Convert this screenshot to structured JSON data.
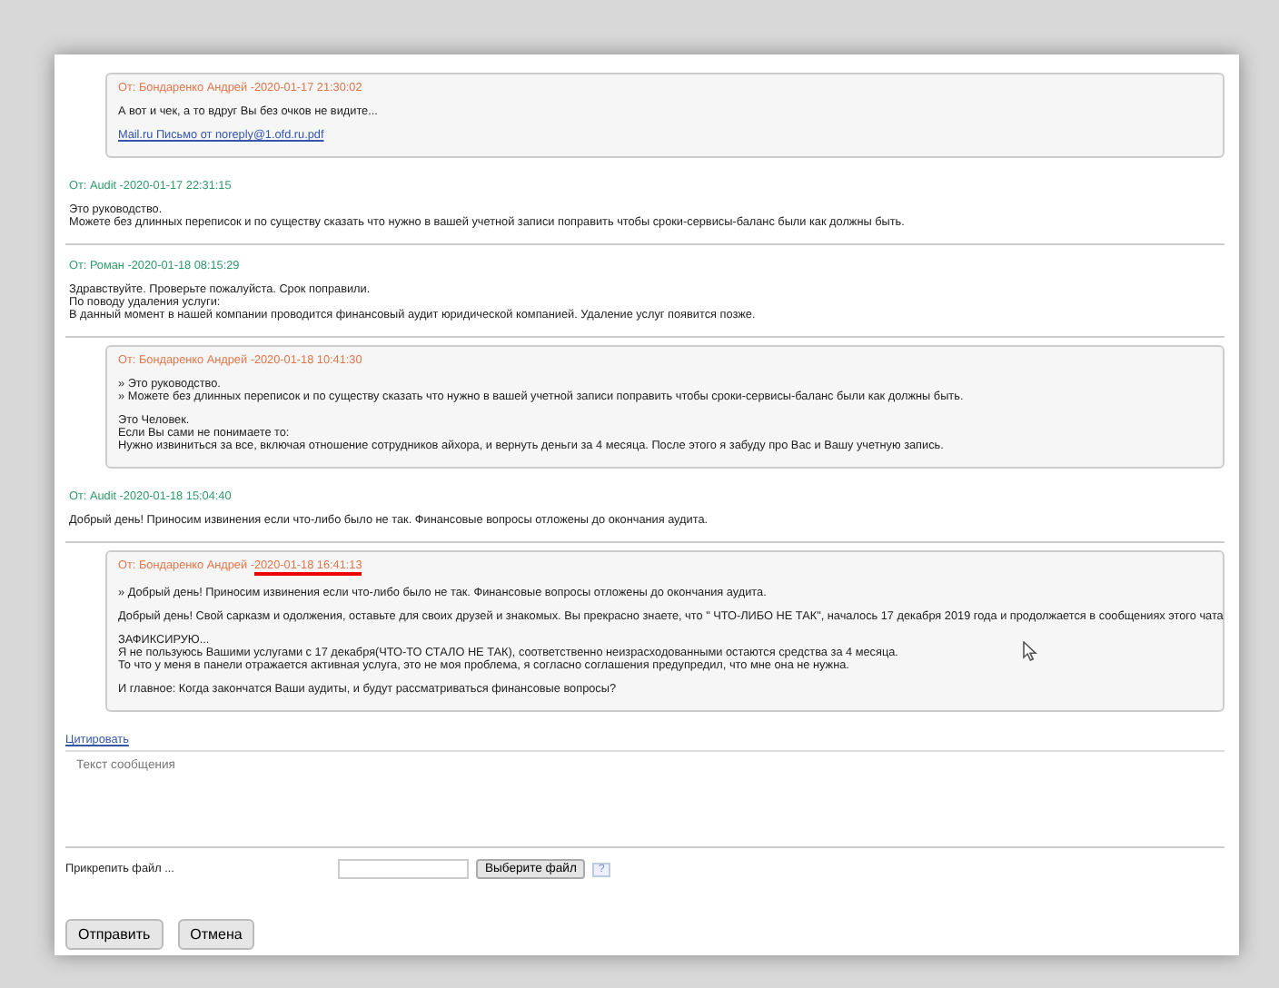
{
  "messages": [
    {
      "kind": "client",
      "author": "От: Бондаренко Андрей - ",
      "date": "2020-01-17 21:30:02",
      "date_marked": false,
      "paragraphs": [
        [
          "А вот и чек, а то вдруг Вы без очков не видите..."
        ]
      ],
      "link": "Mail.ru Письмо от noreply@1.ofd.ru.pdf"
    },
    {
      "kind": "support",
      "author": "От: Audit - ",
      "date": "2020-01-17 22:31:15",
      "date_marked": false,
      "paragraphs": [
        [
          "Это руководство.",
          "Можете без длинных переписок и по существу сказать что нужно в вашей учетной записи поправить чтобы сроки-сервисы-баланс были как должны быть."
        ]
      ]
    },
    {
      "kind": "support",
      "author": "От: Роман - ",
      "date": "2020-01-18 08:15:29",
      "date_marked": false,
      "paragraphs": [
        [
          "Здравствуйте. Проверьте пожалуйста. Срок поправили.",
          "По поводу удаления услуги:",
          "В данный момент в нашей компании проводится финансовый аудит юридической компанией. Удаление услуг появится позже."
        ]
      ]
    },
    {
      "kind": "client",
      "author": "От: Бондаренко Андрей - ",
      "date": "2020-01-18 10:41:30",
      "date_marked": false,
      "paragraphs": [
        [
          "» Это руководство.",
          "» Можете без длинных переписок и по существу сказать что нужно в вашей учетной записи поправить чтобы сроки-сервисы-баланс были как должны быть."
        ],
        [
          "Это Человек.",
          "Если Вы сами не понимаете то:",
          "Нужно извиниться за все, включая отношение сотрудников айхора, и вернуть деньги за 4 месяца. После этого я забуду про Вас и Вашу учетную запись."
        ]
      ]
    },
    {
      "kind": "support",
      "author": "От: Audit - ",
      "date": "2020-01-18 15:04:40",
      "date_marked": false,
      "paragraphs": [
        [
          "Добрый день! Приносим извинения если что-либо было не так. Финансовые вопросы отложены до окончания аудита."
        ]
      ]
    },
    {
      "kind": "client",
      "author": "От: Бондаренко Андрей - ",
      "date": "2020-01-18 16:41:13",
      "date_marked": true,
      "paragraphs": [
        [
          "» Добрый день! Приносим извинения если что-либо было не так. Финансовые вопросы отложены до окончания аудита."
        ],
        [
          "Добрый день! Свой сарказм и одолжения, оставьте для своих друзей и знакомых. Вы прекрасно знаете, что \" ЧТО-ЛИБО НЕ ТАК\", началось 17 декабря 2019 года и продолжается в сообщениях этого чата"
        ],
        [
          "ЗАФИКСИРУЮ...",
          "Я не пользуюсь Вашими услугами с 17 декабря(ЧТО-ТО СТАЛО НЕ ТАК), соответственно неизрасходованными остаются средства за 4 месяца.",
          "То что у меня в панели отражается активная услуга, это не моя проблема, я согласно соглашения предупредил, что мне она не нужна."
        ],
        [
          "И главное: Когда закончатся Ваши аудиты, и будут рассматриваться финансовые вопросы?"
        ]
      ]
    }
  ],
  "quote_link": "Цитировать",
  "reply": {
    "placeholder": "Текст сообщения"
  },
  "attach": {
    "label": "Прикрепить файл ...",
    "button": "Выберите файл",
    "help": "?"
  },
  "buttons": [
    "Отправить",
    "Отмена"
  ]
}
